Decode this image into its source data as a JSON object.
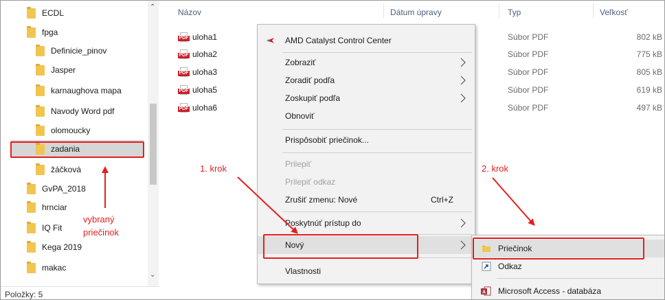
{
  "nav": {
    "items": [
      {
        "label": "ECDL",
        "indent": 1
      },
      {
        "label": "fpga",
        "indent": 1
      },
      {
        "label": "Definicie_pinov",
        "indent": 2
      },
      {
        "label": "Jasper",
        "indent": 2
      },
      {
        "label": "karnaughova mapa",
        "indent": 2
      },
      {
        "label": "Navody Word pdf",
        "indent": 2
      },
      {
        "label": "olomoucky",
        "indent": 2
      },
      {
        "label": "zadania",
        "indent": 2
      },
      {
        "label": "žáčková",
        "indent": 2
      },
      {
        "label": "GvPA_2018",
        "indent": 1
      },
      {
        "label": "hrnciar",
        "indent": 1
      },
      {
        "label": "IQ Fit",
        "indent": 1
      },
      {
        "label": "Kega 2019",
        "indent": 1
      },
      {
        "label": "makac",
        "indent": 1
      }
    ],
    "selected_index": 7
  },
  "status": {
    "items_count": "Položky: 5"
  },
  "columns": {
    "name": "Názov",
    "date": "Dátum úpravy",
    "type": "Typ",
    "size": "Veľkosť"
  },
  "files": [
    {
      "name": "uloha1",
      "type": "Súbor PDF",
      "size": "802 kB"
    },
    {
      "name": "uloha2",
      "type": "Súbor PDF",
      "size": "775 kB"
    },
    {
      "name": "uloha3",
      "type": "Súbor PDF",
      "size": "805 kB"
    },
    {
      "name": "uloha5",
      "type": "Súbor PDF",
      "size": "619 kB"
    },
    {
      "name": "uloha6",
      "type": "Súbor PDF",
      "size": "497 kB"
    }
  ],
  "pdf_icon_text": "PDF",
  "context_menu": {
    "amd": "AMD Catalyst Control Center",
    "view": "Zobraziť",
    "sort_by": "Zoradiť podľa",
    "group_by": "Zoskupiť podľa",
    "refresh": "Obnoviť",
    "customize": "Prispôsobiť priečinok...",
    "paste": "Prilepiť",
    "paste_shortcut": "Prilepiť odkaz",
    "undo": "Zrušiť zmenu: Nové",
    "undo_key": "Ctrl+Z",
    "share": "Poskytnúť prístup do",
    "new": "Nový",
    "properties": "Vlastnosti"
  },
  "submenu": {
    "folder": "Priečinok",
    "shortcut": "Odkaz",
    "access": "Microsoft Access - databáza"
  },
  "annotations": {
    "step1": "1. krok",
    "step2": "2. krok",
    "selected_folder_line1": "vybraný",
    "selected_folder_line2": "priečinok"
  },
  "colors": {
    "annotation": "#e41e1e",
    "folder": "#f1c550",
    "pdf_red": "#c8202a"
  }
}
